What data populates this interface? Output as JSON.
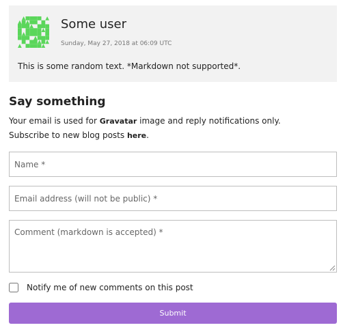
{
  "comment": {
    "author": "Some user",
    "timestamp": "Sunday, May 27, 2018 at 06:09 UTC",
    "body": "This is some random text. *Markdown not supported*.",
    "avatar_icon": "identicon-avatar",
    "avatar_color": "#5bd65b"
  },
  "form": {
    "heading": "Say something",
    "note_prefix": "Your email is used for ",
    "note_link": "Gravatar",
    "note_suffix": " image and reply notifications only.",
    "subscribe_prefix": "Subscribe to new blog posts ",
    "subscribe_link": "here",
    "subscribe_suffix": ".",
    "name_placeholder": "Name *",
    "email_placeholder": "Email address (will not be public) *",
    "comment_placeholder": "Comment (markdown is accepted) *",
    "notify_label": "Notify me of new comments on this post",
    "submit_label": "Submit",
    "accent_color": "#9e6ad3"
  }
}
